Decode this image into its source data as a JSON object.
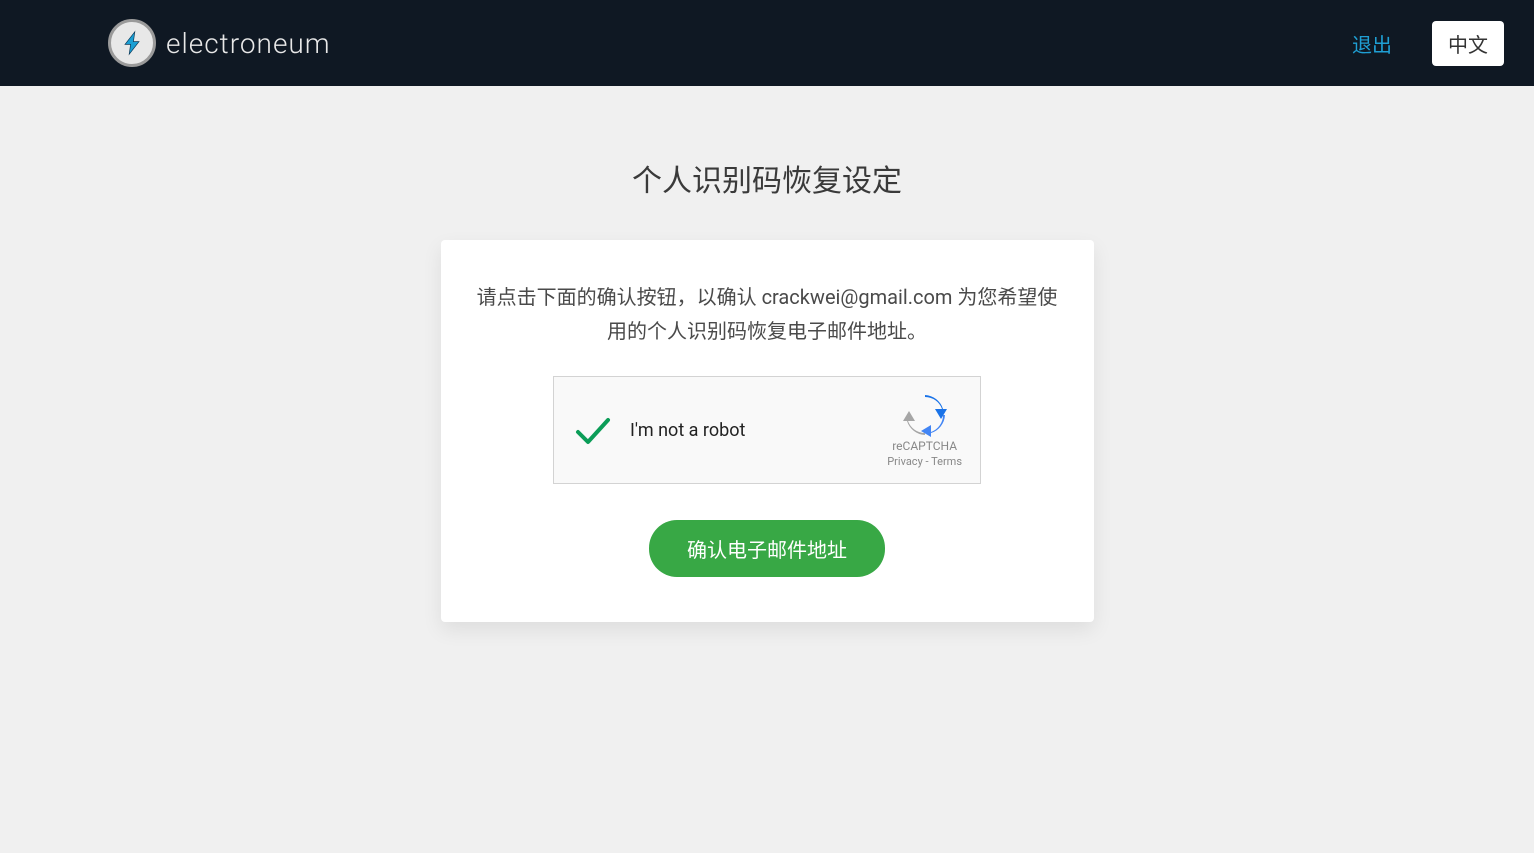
{
  "header": {
    "brand_name": "electroneum",
    "logout_label": "退出",
    "language_label": "中文"
  },
  "main": {
    "title": "个人识别码恢复设定",
    "card": {
      "instruction_text": "请点击下面的确认按钮，以确认 crackwei@gmail.com 为您希望使用的个人识别码恢复电子邮件地址。",
      "confirm_button_label": "确认电子邮件地址"
    },
    "recaptcha": {
      "label": "I'm not a robot",
      "title": "reCAPTCHA",
      "privacy_label": "Privacy",
      "terms_label": "Terms",
      "separator": " - "
    }
  }
}
